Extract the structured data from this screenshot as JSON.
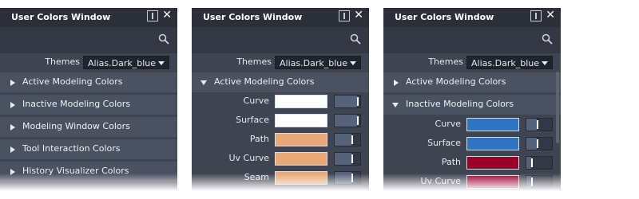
{
  "panels": [
    {
      "title": "User Colors Window",
      "themes_label": "Themes",
      "themes_value": "Alias.Dark_blue",
      "sections": [
        {
          "label": "Active Modeling Colors",
          "expanded": false
        },
        {
          "label": "Inactive Modeling Colors",
          "expanded": false
        },
        {
          "label": "Modeling Window Colors",
          "expanded": false
        },
        {
          "label": "Tool Interaction Colors",
          "expanded": false
        },
        {
          "label": "History Visualizer Colors",
          "expanded": false
        }
      ]
    },
    {
      "title": "User Colors Window",
      "themes_label": "Themes",
      "themes_value": "Alias.Dark_blue",
      "section": {
        "label": "Active Modeling Colors",
        "expanded": true
      },
      "rows": [
        {
          "label": "Curve",
          "color": "#ffffff",
          "alpha": 0.95
        },
        {
          "label": "Surface",
          "color": "#ffffff",
          "alpha": 0.95
        },
        {
          "label": "Path",
          "color": "#e8a877",
          "alpha": 0.72
        },
        {
          "label": "Uv Curve",
          "color": "#e8a877",
          "alpha": 0.72
        },
        {
          "label": "Seam",
          "color": "#e8a877",
          "alpha": 0.72
        }
      ]
    },
    {
      "title": "User Colors Window",
      "themes_label": "Themes",
      "themes_value": "Alias.Dark_blue",
      "sections": [
        {
          "label": "Active Modeling Colors",
          "expanded": false
        },
        {
          "label": "Inactive Modeling Colors",
          "expanded": true
        }
      ],
      "rows": [
        {
          "label": "Curve",
          "color": "#2e74c4",
          "alpha": 0.45
        },
        {
          "label": "Surface",
          "color": "#2e74c4",
          "alpha": 0.45
        },
        {
          "label": "Path",
          "color": "#99002a",
          "alpha": 0.2
        },
        {
          "label": "Uv Curve",
          "color": "#99002a",
          "alpha": 0.2
        }
      ]
    }
  ]
}
